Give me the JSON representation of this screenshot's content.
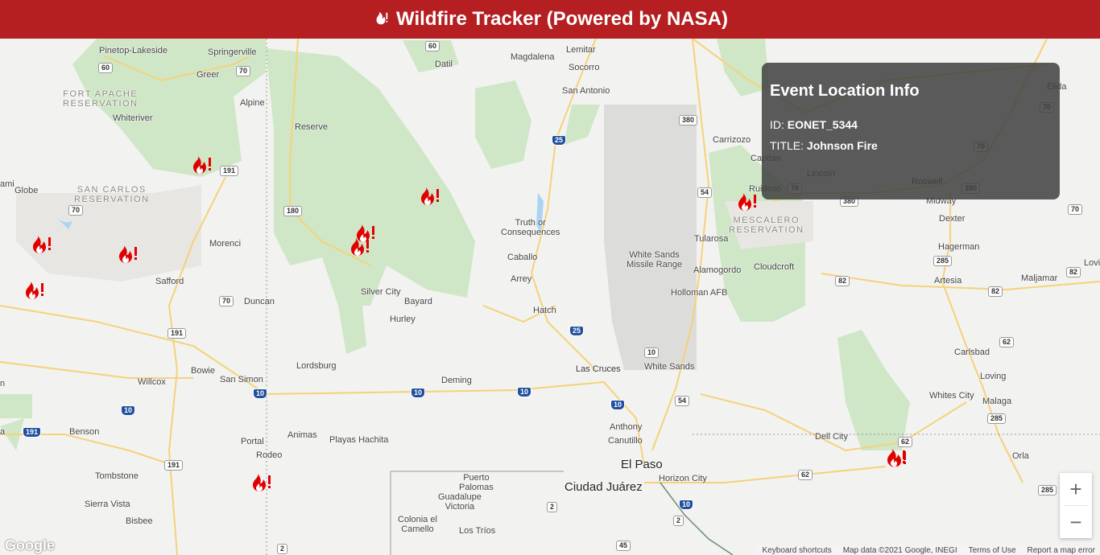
{
  "header": {
    "title": "Wildfire Tracker (Powered by NASA)",
    "logo_icon": "fire-icon"
  },
  "info_box": {
    "title": "Event Location Info",
    "id_label": "ID:",
    "id_value": "EONET_5344",
    "title_label": "TITLE:",
    "title_value": "Johnson Fire"
  },
  "places": [
    {
      "name": "Pinetop-Lakeside"
    },
    {
      "name": "Springerville"
    },
    {
      "name": "Greer"
    },
    {
      "name": "Alpine"
    },
    {
      "name": "FORT APACHE\nRESERVATION"
    },
    {
      "name": "Whiteriver"
    },
    {
      "name": "Reserve"
    },
    {
      "name": "Datil"
    },
    {
      "name": "Magdalena"
    },
    {
      "name": "Lemitar"
    },
    {
      "name": "Socorro"
    },
    {
      "name": "San Antonio"
    },
    {
      "name": "Carrizozo"
    },
    {
      "name": "Capitan"
    },
    {
      "name": "Lincoln"
    },
    {
      "name": "Ruidoso"
    },
    {
      "name": "Roswell"
    },
    {
      "name": "Elida"
    },
    {
      "name": "Midway"
    },
    {
      "name": "Dexter"
    },
    {
      "name": "Hagerman"
    },
    {
      "name": "Artesia"
    },
    {
      "name": "Maljamar"
    },
    {
      "name": "Lovi"
    },
    {
      "name": "SAN CARLOS\nRESERVATION"
    },
    {
      "name": "Globe"
    },
    {
      "name": "ami"
    },
    {
      "name": "Morenci"
    },
    {
      "name": "Safford"
    },
    {
      "name": "Duncan"
    },
    {
      "name": "Truth or\nConsequences"
    },
    {
      "name": "Caballo"
    },
    {
      "name": "Arrey"
    },
    {
      "name": "Hatch"
    },
    {
      "name": "Silver City"
    },
    {
      "name": "Bayard"
    },
    {
      "name": "Hurley"
    },
    {
      "name": "White Sands\nMissile Range"
    },
    {
      "name": "Tularosa"
    },
    {
      "name": "Alamogordo"
    },
    {
      "name": "Cloudcroft"
    },
    {
      "name": "Holloman AFB"
    },
    {
      "name": "MESCALERO\nRESERVATION"
    },
    {
      "name": "Lordsburg"
    },
    {
      "name": "Deming"
    },
    {
      "name": "Las Cruces"
    },
    {
      "name": "White Sands"
    },
    {
      "name": "Bowie"
    },
    {
      "name": "San Simon"
    },
    {
      "name": "Willcox"
    },
    {
      "name": "Benson"
    },
    {
      "name": "Animas"
    },
    {
      "name": "Playas Hachita"
    },
    {
      "name": "Portal"
    },
    {
      "name": "Rodeo"
    },
    {
      "name": "Tombstone"
    },
    {
      "name": "Sierra Vista"
    },
    {
      "name": "Bisbee"
    },
    {
      "name": "Anthony"
    },
    {
      "name": "Canutillo"
    },
    {
      "name": "El Paso"
    },
    {
      "name": "Ciudad Juárez"
    },
    {
      "name": "Horizon City"
    },
    {
      "name": "Puerto\nPalomas"
    },
    {
      "name": "Guadalupe\nVictoria"
    },
    {
      "name": "Colonia el\nCamello"
    },
    {
      "name": "Los Tríos"
    },
    {
      "name": "Dell City"
    },
    {
      "name": "Carlsbad"
    },
    {
      "name": "Loving"
    },
    {
      "name": "Whites City"
    },
    {
      "name": "Malaga"
    },
    {
      "name": "Orla"
    },
    {
      "name": "n"
    },
    {
      "name": "a"
    }
  ],
  "shields": [
    {
      "label": "60"
    },
    {
      "label": "60"
    },
    {
      "label": "191"
    },
    {
      "label": "191"
    },
    {
      "label": "180"
    },
    {
      "label": "25"
    },
    {
      "label": "380"
    },
    {
      "label": "380"
    },
    {
      "label": "380"
    },
    {
      "label": "70"
    },
    {
      "label": "70"
    },
    {
      "label": "70"
    },
    {
      "label": "70"
    },
    {
      "label": "54"
    },
    {
      "label": "54"
    },
    {
      "label": "82"
    },
    {
      "label": "82"
    },
    {
      "label": "82"
    },
    {
      "label": "285"
    },
    {
      "label": "285"
    },
    {
      "label": "285"
    },
    {
      "label": "62"
    },
    {
      "label": "62"
    },
    {
      "label": "62"
    },
    {
      "label": "25"
    },
    {
      "label": "70"
    },
    {
      "label": "10"
    },
    {
      "label": "10"
    },
    {
      "label": "10"
    },
    {
      "label": "10"
    },
    {
      "label": "10"
    },
    {
      "label": "10"
    },
    {
      "label": "191"
    },
    {
      "label": "191"
    },
    {
      "label": "2"
    },
    {
      "label": "2"
    },
    {
      "label": "2"
    },
    {
      "label": "45"
    },
    {
      "label": "10"
    },
    {
      "label": "70"
    },
    {
      "label": "70"
    }
  ],
  "fires": [
    {
      "name": "fire-1"
    },
    {
      "name": "fire-2"
    },
    {
      "name": "fire-3"
    },
    {
      "name": "fire-4"
    },
    {
      "name": "fire-5"
    },
    {
      "name": "fire-6"
    },
    {
      "name": "fire-7"
    },
    {
      "name": "fire-8"
    },
    {
      "name": "fire-9"
    },
    {
      "name": "fire-10"
    },
    {
      "name": "fire-11"
    }
  ],
  "zoom": {
    "in_label": "+",
    "out_label": "−"
  },
  "google_logo": "Google",
  "footer": [
    "Keyboard shortcuts",
    "Map data ©2021 Google, INEGI",
    "Terms of Use",
    "Report a map error"
  ],
  "colors": {
    "header_bg": "#b51f21",
    "fire": "#e00000",
    "park": "#cfe7c6",
    "road": "#f5d27a"
  }
}
